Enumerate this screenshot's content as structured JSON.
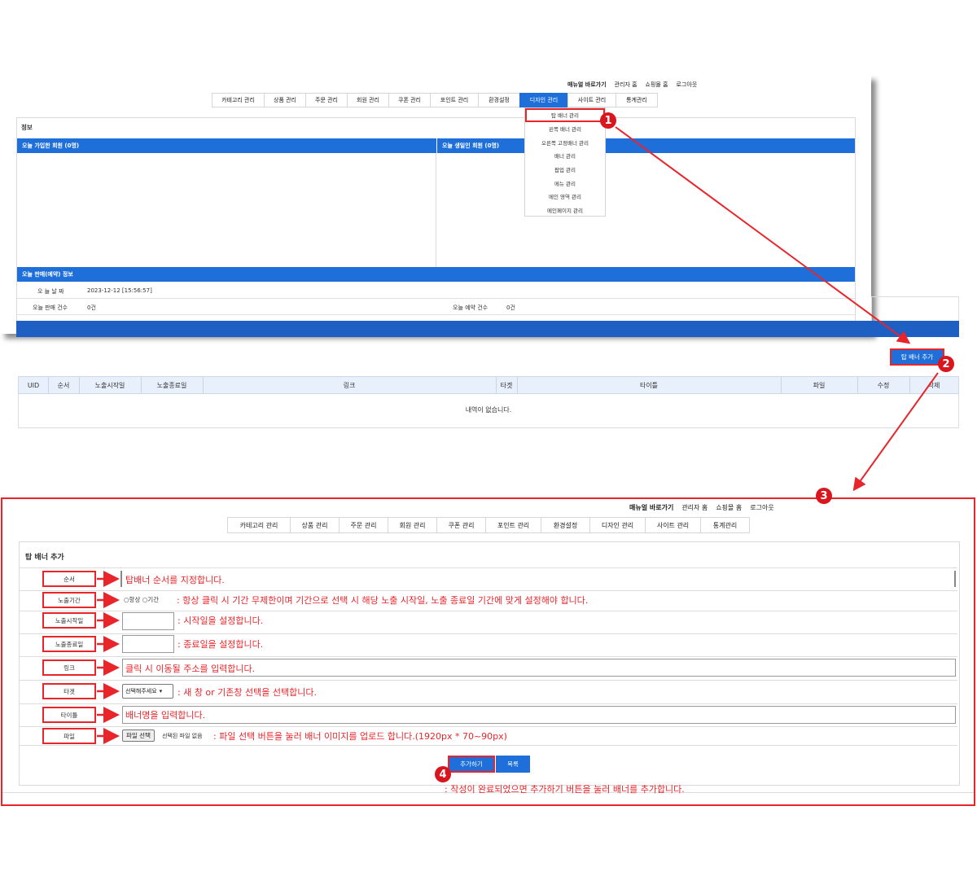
{
  "topbar": {
    "manual_link": "매뉴얼 바로가기",
    "admin_home": "관리자 홈",
    "shop_home": "쇼핑몰 홈",
    "logout": "로그아웃"
  },
  "nav": {
    "items": [
      "카테고리 관리",
      "상품 관리",
      "주문 관리",
      "회원 관리",
      "쿠폰 관리",
      "포인트 관리",
      "환경설정",
      "디자인 관리",
      "사이트 관리",
      "통계관리"
    ]
  },
  "dropdown": {
    "items": [
      "탑 배너 관리",
      "왼쪽 배너 관리",
      "오른쪽 고정배너 관리",
      "배너 관리",
      "팝업 관리",
      "메뉴 관리",
      "메인 영역 관리",
      "메인페이지 관리"
    ]
  },
  "dashboard": {
    "section_title": "정보",
    "new_members": "오늘 가입한 회원 (0명)",
    "birthday_members": "오늘 생일인 회원 (0명)",
    "sales_header": "오늘 판매(예약) 정보",
    "date_label": "오 늘 날 짜",
    "date_value": "2023-12-12 [15:56:57]",
    "sales_label": "오늘 판매 건수",
    "sales_value": "0건",
    "reserve_label": "오늘 예약 건수",
    "reserve_value": "0건"
  },
  "list": {
    "add_button": "탑 배너 추가",
    "columns": [
      "UID",
      "순서",
      "노출시작일",
      "노출종료일",
      "링크",
      "타겟",
      "타이틀",
      "파일",
      "수정",
      "삭제"
    ],
    "empty_message": "내역이 없습니다."
  },
  "form": {
    "title": "탑 배너 추가",
    "labels": {
      "order": "순서",
      "period": "노출기간",
      "start": "노출시작일",
      "end": "노출종료일",
      "link": "링크",
      "target": "타겟",
      "title": "타이틀",
      "file": "파일"
    },
    "radio_always": "항상",
    "radio_period": "기간",
    "target_placeholder": "선택해주세요",
    "file_button": "파일 선택",
    "file_none": "선택된 파일 없음",
    "submit_button": "추가하기",
    "list_button": "목록"
  },
  "notes": {
    "order": "탑배너 순서를 지정합니다.",
    "period": ": 항상 클릭 시 기간 무제한이며 기간으로 선택 시 해당 노출 시작일, 노출 종료일 기간에 맞게 설정해야 합니다.",
    "start": ": 시작일을 설정합니다.",
    "end": ": 종료일을 설정합니다.",
    "link": "클릭 시 이동될 주소를 입력합니다.",
    "target": ": 새 창 or 기존창 선택을 선택합니다.",
    "title": "배너명을 입력합니다.",
    "file": ": 파일 선택 버튼을 눌러 배너 이미지를 업로드 합니다.(1920px * 70~90px)",
    "submit": ": 작성이 완료되었으면 추가하기 버튼을 눌러 배너를 추가합니다."
  },
  "steps": [
    "1",
    "2",
    "3",
    "4"
  ],
  "colors": {
    "accent": "#1e6fd9",
    "annotation": "#e8252a"
  }
}
